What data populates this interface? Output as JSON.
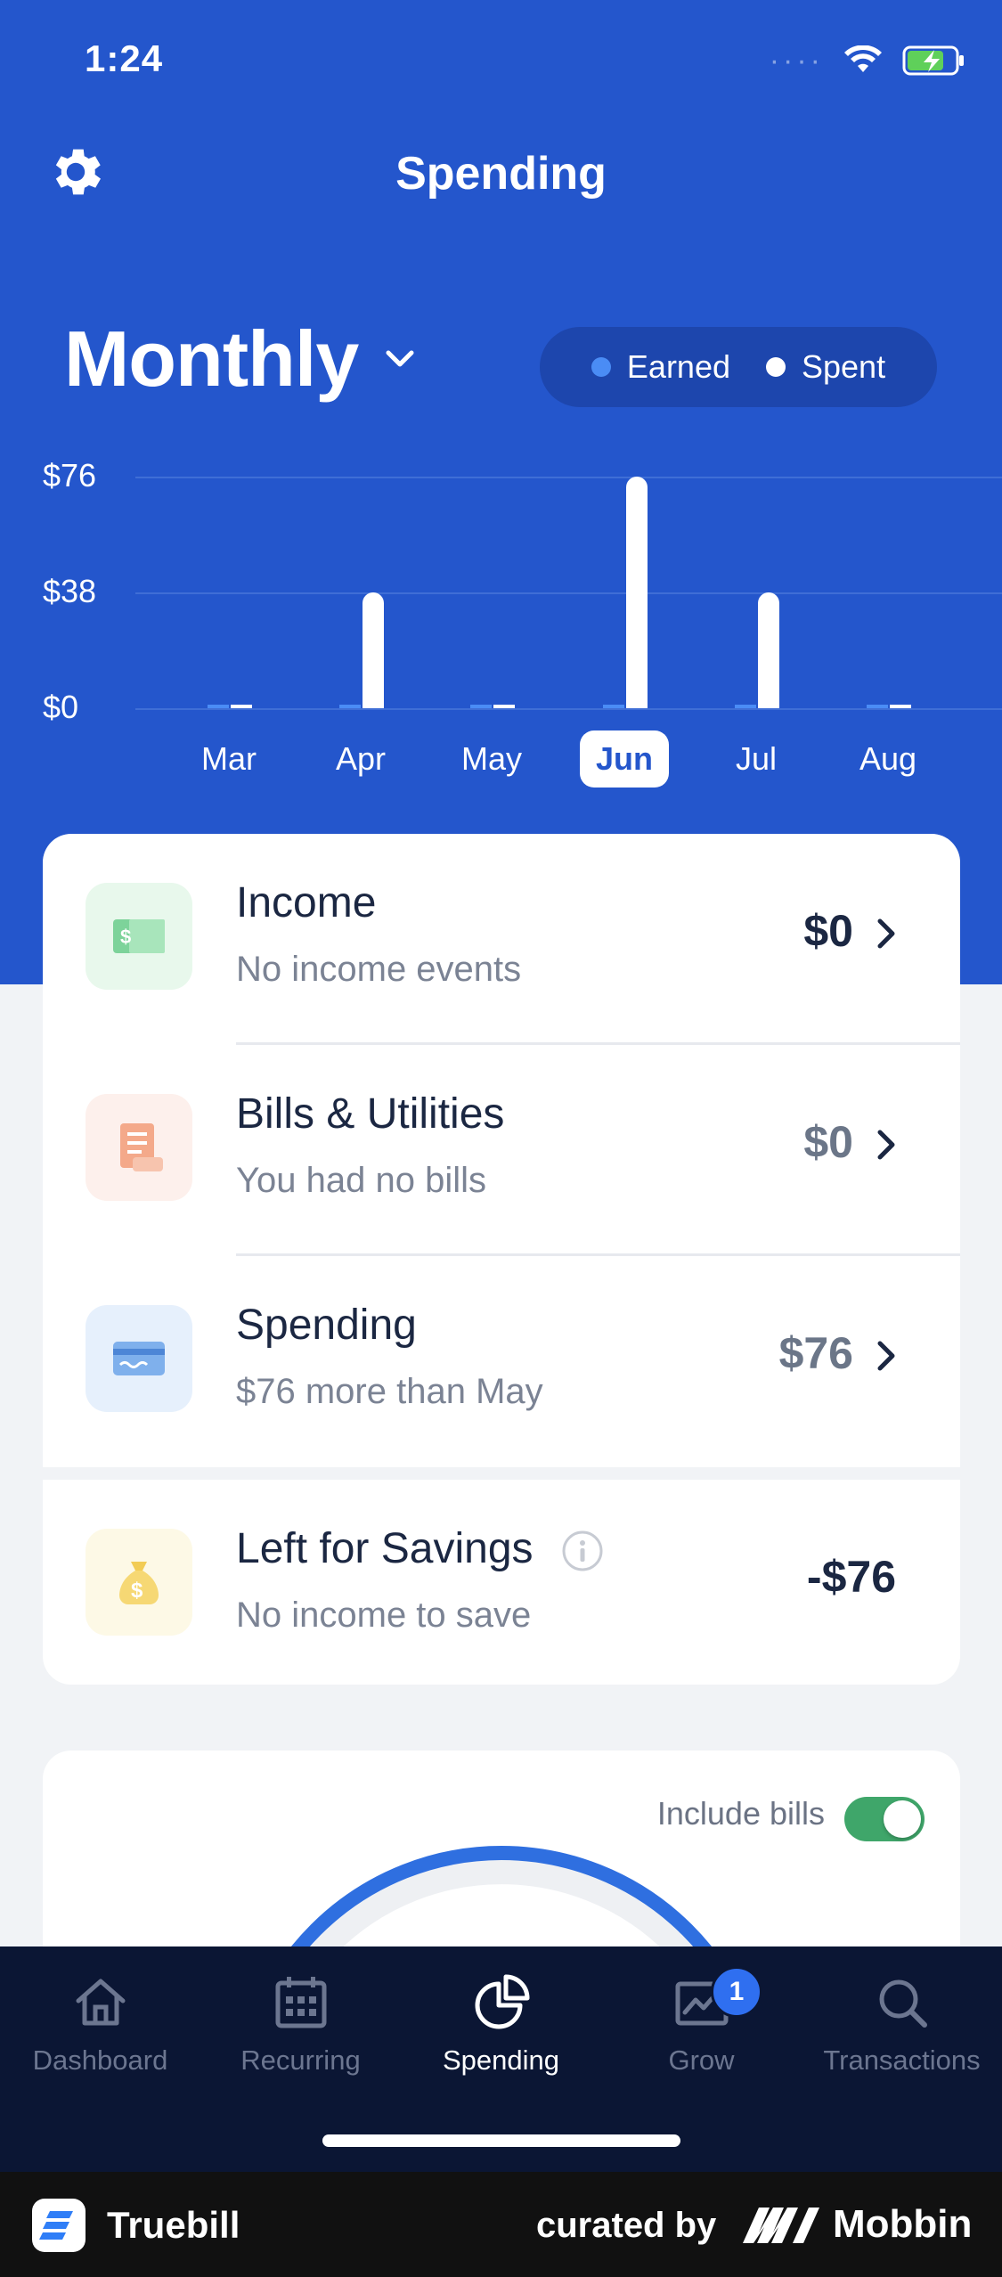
{
  "status_bar": {
    "time": "1:24"
  },
  "header": {
    "title": "Spending"
  },
  "period": {
    "selected": "Monthly"
  },
  "legend": {
    "earned": "Earned",
    "spent": "Spent"
  },
  "colors": {
    "brand": "#2456cc",
    "earned": "#4a8cf5",
    "spent": "#ffffff",
    "tabbar": "#0b1634",
    "toggle_on": "#3fa66a"
  },
  "chart_data": {
    "type": "bar",
    "categories": [
      "Mar",
      "Apr",
      "May",
      "Jun",
      "Jul",
      "Aug"
    ],
    "series": [
      {
        "name": "Earned",
        "values": [
          0,
          0,
          0,
          0,
          0,
          0
        ]
      },
      {
        "name": "Spent",
        "values": [
          0,
          38,
          0,
          76,
          38,
          0
        ]
      }
    ],
    "y_ticks": [
      "$76",
      "$38",
      "$0"
    ],
    "ylim": [
      0,
      76
    ],
    "selected_category": "Jun",
    "grid": true,
    "legend_position": "top-right"
  },
  "summary": [
    {
      "title": "Income",
      "subtitle": "No income events",
      "amount": "$0",
      "icon": "cash-icon"
    },
    {
      "title": "Bills & Utilities",
      "subtitle": "You had no bills",
      "amount": "$0",
      "icon": "receipt-icon"
    },
    {
      "title": "Spending",
      "subtitle": "$76 more than May",
      "amount": "$76",
      "icon": "credit-card-icon"
    },
    {
      "title": "Left for Savings",
      "subtitle": "No income to save",
      "amount": "-$76",
      "icon": "money-bag-icon"
    }
  ],
  "bills_toggle": {
    "label": "Include bills",
    "on": true
  },
  "tabs": [
    {
      "label": "Dashboard",
      "icon": "home-icon"
    },
    {
      "label": "Recurring",
      "icon": "calendar-icon"
    },
    {
      "label": "Spending",
      "icon": "pie-chart-icon",
      "active": true
    },
    {
      "label": "Grow",
      "icon": "growth-chart-icon",
      "badge": "1"
    },
    {
      "label": "Transactions",
      "icon": "search-icon"
    }
  ],
  "footer": {
    "app_name": "Truebill",
    "curated_by": "curated by",
    "brand": "Mobbin"
  }
}
